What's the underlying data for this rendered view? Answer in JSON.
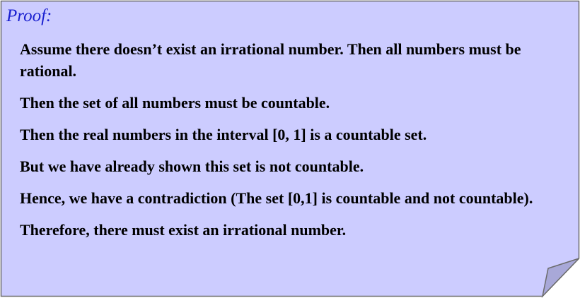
{
  "note": {
    "fill_color": "#ccccff",
    "border_color": "#6b6b6b",
    "title_color": "#1a20d0",
    "title": "Proof:",
    "lines": [
      "Assume there doesn’t exist an irrational number. Then all numbers must be rational.",
      "Then the set of all numbers must be countable.",
      "Then the real numbers in the interval [0, 1] is a countable set.",
      "But we have already shown this set is not countable.",
      "Hence, we have a contradiction (The set [0,1] is countable and not countable).",
      "Therefore, there must exist an irrational number."
    ]
  }
}
